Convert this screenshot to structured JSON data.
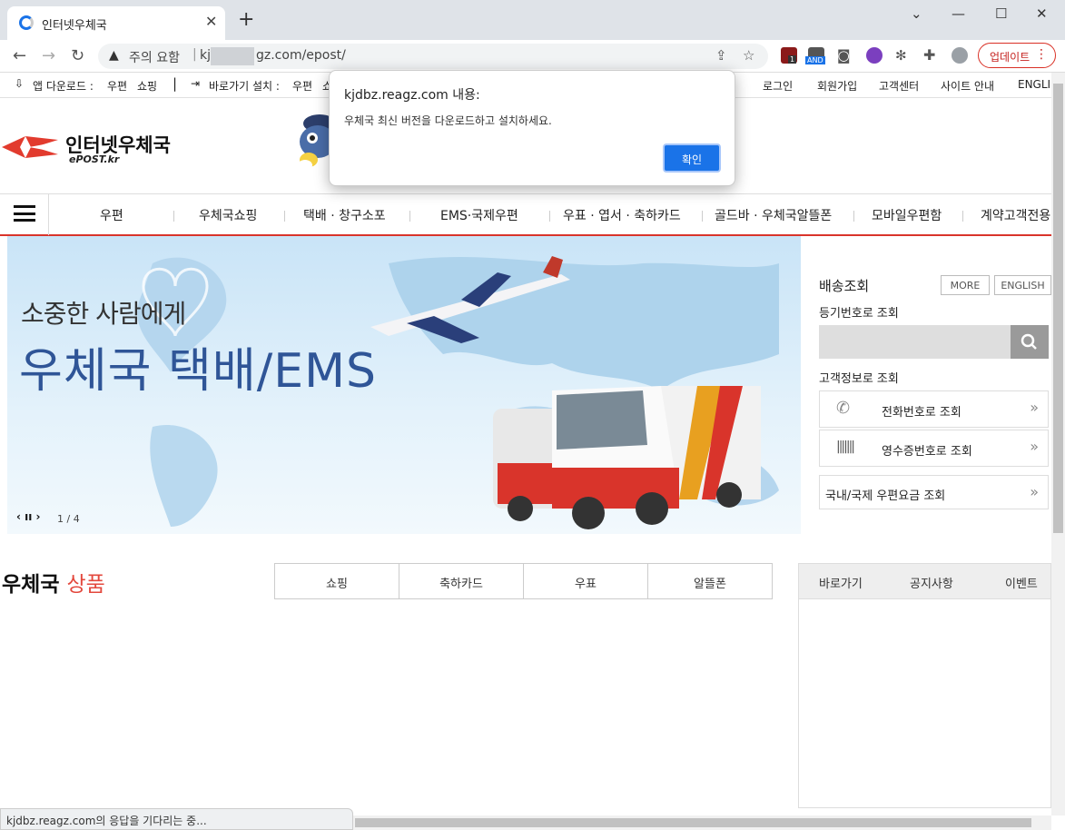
{
  "browser": {
    "tab_title": "인터넷우체국",
    "new_tab": "+",
    "security_warning": "주의 요함",
    "url_prefix": "kj",
    "url_suffix": "gz.com/epost/",
    "update_button": "업데이트",
    "ext_badge_1": "1",
    "ext_badge_and": "AND"
  },
  "bookmarks": {
    "app_download_label": "앱 다운로드 :",
    "app_postal": "우편",
    "app_shopping": "쇼핑",
    "shortcut_label": "바로가기 설치 :",
    "shortcut_postal": "우편",
    "shortcut_trunc": "쇼"
  },
  "dialog": {
    "origin": "kjdbz.reagz.com 내용:",
    "message": "우체국 최신 버전을 다운로드하고 설치하세요.",
    "ok_label": "확인"
  },
  "site": {
    "logo_title": "인터넷우체국",
    "logo_sub": "ePOST.kr",
    "top_links": [
      "로그인",
      "회원가입",
      "고객센터",
      "사이트 안내",
      "ENGLI"
    ],
    "gnb": [
      "우편",
      "우체국쇼핑",
      "택배 · 창구소포",
      "EMS·국제우편",
      "우표 · 엽서 · 축하카드",
      "골드바 · 우체국알뜰폰",
      "모바일우편함",
      "계약고객전용"
    ],
    "banner_subtitle": "소중한 사람에게",
    "banner_title": "우체국 택배/EMS",
    "banner_page": "1 / 4",
    "banner_controls": "‹ ıı ›"
  },
  "tracking": {
    "title": "배송조회",
    "more": "MORE",
    "english": "ENGLISH",
    "reg_label": "등기번호로 조회",
    "cust_label": "고객정보로 조회",
    "phone_lookup": "전화번호로 조회",
    "receipt_lookup": "영수증번호로 조회",
    "rate_lookup": "국내/국제 우편요금 조회"
  },
  "products": {
    "title_black": "우체국",
    "title_red": "상품",
    "tabs": [
      "쇼핑",
      "축하카드",
      "우표",
      "알뜰폰"
    ]
  },
  "side_tabs": [
    "바로가기",
    "공지사항",
    "이벤트"
  ],
  "status_text": "kjdbz.reagz.com의 응답을 기다리는 중..."
}
